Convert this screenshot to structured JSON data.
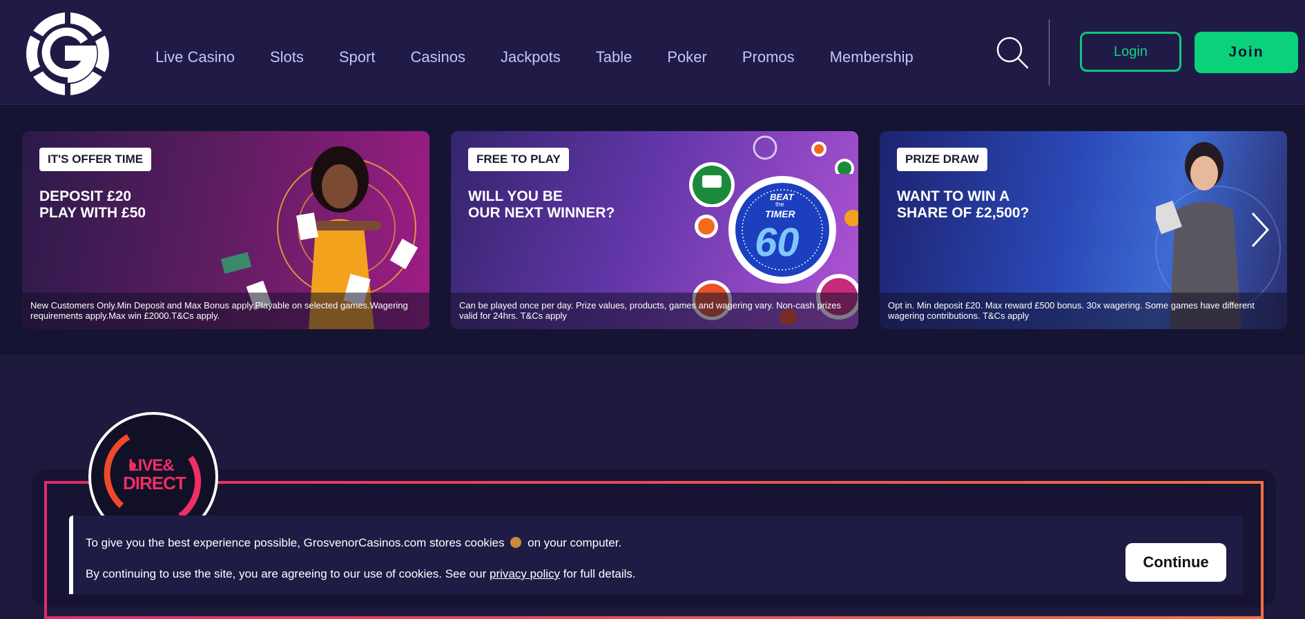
{
  "header": {
    "nav": [
      "Live Casino",
      "Slots",
      "Sport",
      "Casinos",
      "Jackpots",
      "Table",
      "Poker",
      "Promos",
      "Membership"
    ],
    "login_label": "Login",
    "join_label": "Join"
  },
  "promos": [
    {
      "badge": "IT'S OFFER TIME",
      "headline_1": "DEPOSIT £20",
      "headline_2": "PLAY WITH £50",
      "terms_1": "New Customers Only.Min Deposit and Max Bonus apply.Playable on selected games.Wagering",
      "terms_2": "requirements apply.Max win £2000.T&Cs apply."
    },
    {
      "badge": "FREE TO PLAY",
      "headline_1": "WILL YOU BE",
      "headline_2": "OUR NEXT WINNER?",
      "timer_top": "BEAT",
      "timer_mid": "the",
      "timer_label": "TIMER",
      "timer_value": "60",
      "terms_1": "Can be played once per day. Prize values, products, games and wagering vary. Non-cash prizes",
      "terms_2": "valid for 24hrs. T&Cs apply"
    },
    {
      "badge": "PRIZE DRAW",
      "headline_1": "WANT TO WIN A",
      "headline_2": "SHARE OF £2,500?",
      "terms_1": "Opt in. Min deposit £20. Max reward £500 bonus. 30x wagering. Some games have different",
      "terms_2": "wagering contributions. T&Cs apply"
    }
  ],
  "live": {
    "line1": "LIVE&",
    "line2": "DIRECT"
  },
  "cookie": {
    "line1_a": "To give you the best experience possible, GrosvenorCasinos.com stores cookies",
    "line1_b": "on your computer.",
    "line2_a": "By continuing to use the site, you are agreeing to our use of cookies. See our",
    "link": "privacy policy",
    "line2_b": "for full details.",
    "continue_label": "Continue"
  },
  "colors": {
    "accent_green": "#0ad17a",
    "header_bg": "#1f1b46",
    "live_red": "#ee2f63"
  }
}
